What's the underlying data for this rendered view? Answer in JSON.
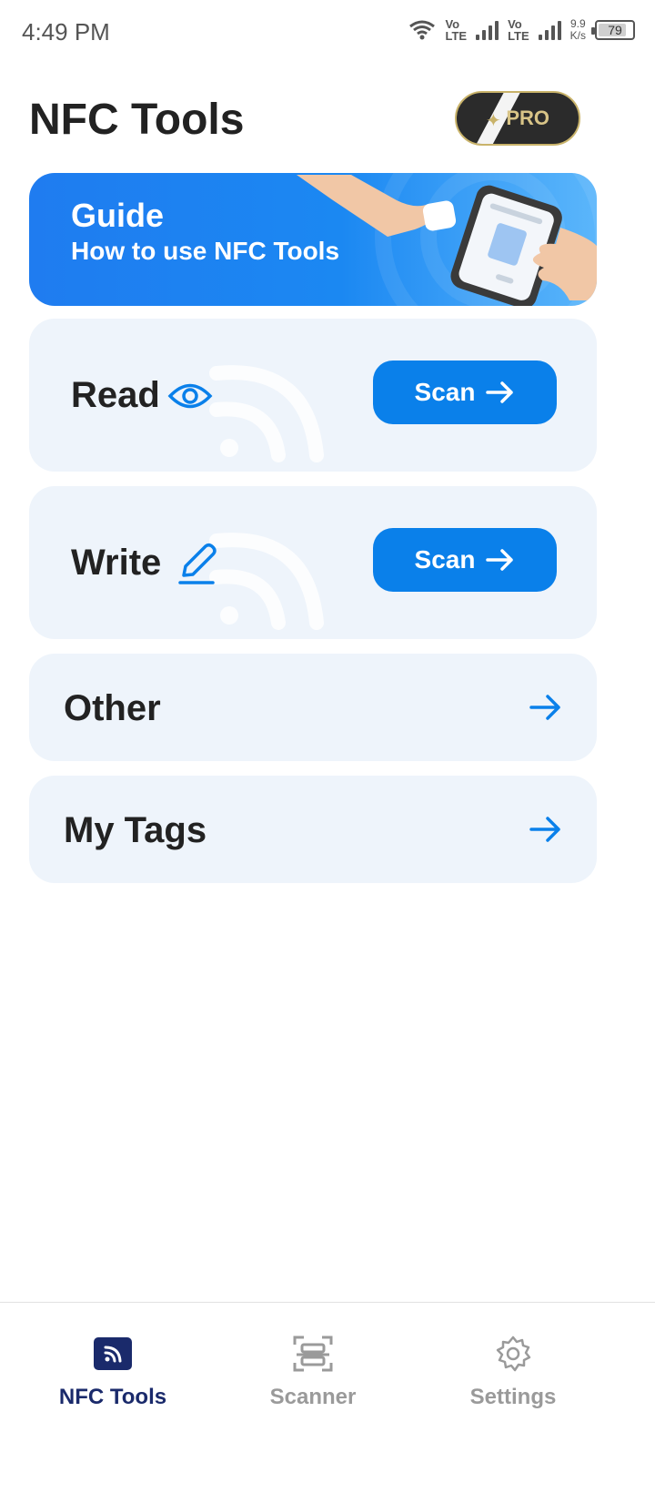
{
  "status_bar": {
    "time": "4:49 PM",
    "volte1_top": "Vo",
    "volte1_bottom": "LTE",
    "volte2_top": "Vo",
    "volte2_bottom": "LTE",
    "speed_value": "9.9",
    "speed_unit": "K/s",
    "battery": "79"
  },
  "header": {
    "title": "NFC Tools",
    "pro_label": "PRO"
  },
  "guide": {
    "title": "Guide",
    "subtitle": "How to use NFC Tools"
  },
  "cards": {
    "read": {
      "label": "Read",
      "button": "Scan",
      "icon": "eye-icon"
    },
    "write": {
      "label": "Write",
      "button": "Scan",
      "icon": "pencil-icon"
    },
    "other": {
      "label": "Other",
      "icon": "arrow-right-icon"
    },
    "tags": {
      "label": "My Tags",
      "icon": "arrow-right-icon"
    }
  },
  "bottom_nav": {
    "items": [
      {
        "label": "NFC Tools",
        "icon": "nfc-icon",
        "active": true
      },
      {
        "label": "Scanner",
        "icon": "scanner-icon",
        "active": false
      },
      {
        "label": "Settings",
        "icon": "gear-icon",
        "active": false
      }
    ]
  },
  "colors": {
    "accent": "#0a80ea",
    "nav_active": "#1a2a6b",
    "card_bg": "#eef4fb",
    "pro_gold": "#c9b36a"
  }
}
